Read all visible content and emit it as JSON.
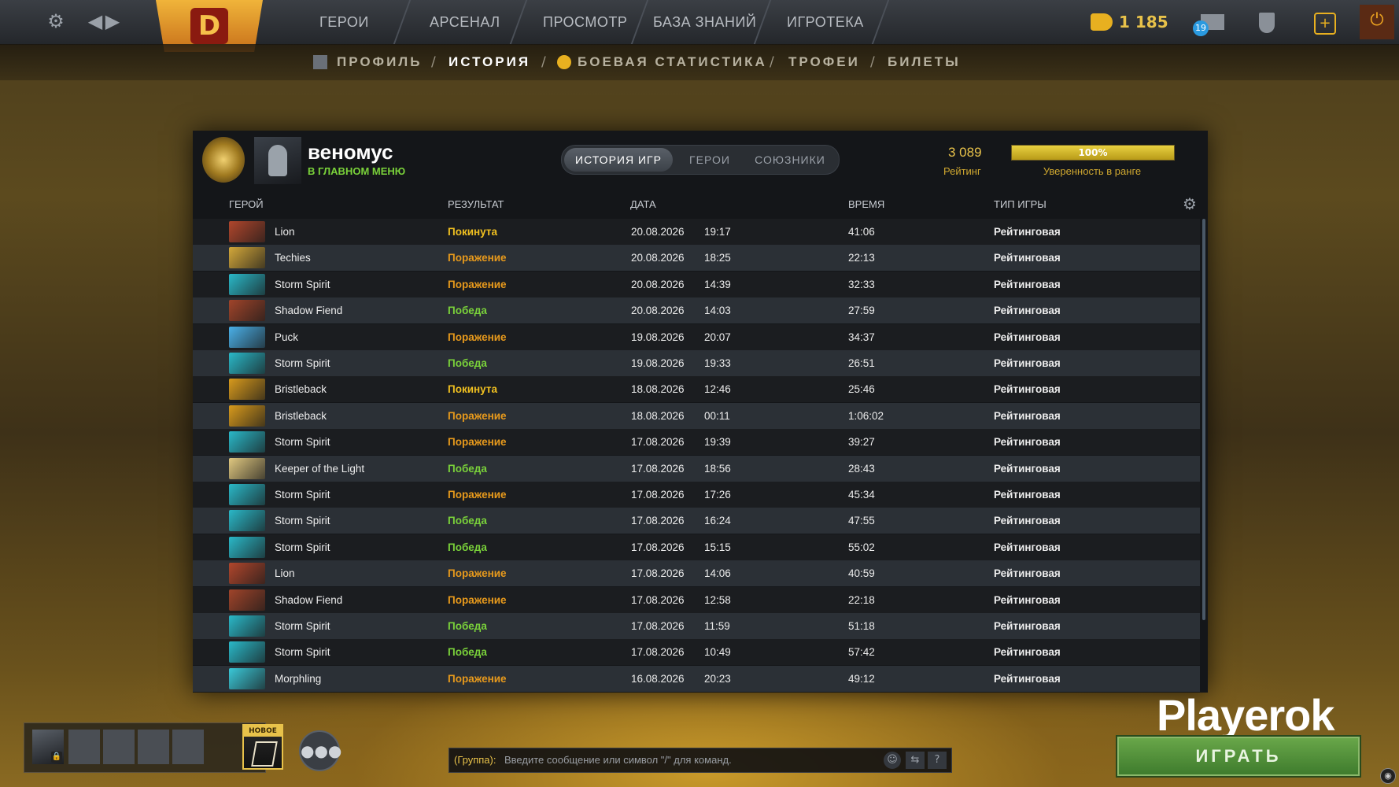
{
  "topbar": {
    "nav": [
      "ГЕРОИ",
      "АРСЕНАЛ",
      "ПРОСМОТР",
      "БАЗА ЗНАНИЙ",
      "ИГРОТЕКА"
    ],
    "gold": "1 185",
    "mail_count": "19"
  },
  "subnav": {
    "items": [
      "ПРОФИЛЬ",
      "ИСТОРИЯ",
      "БОЕВАЯ СТАТИСТИКА",
      "ТРОФЕИ",
      "БИЛЕТЫ"
    ],
    "active": "ИСТОРИЯ"
  },
  "profile": {
    "name": "веномус",
    "status": "В ГЛАВНОМ МЕНЮ",
    "tabs": [
      "ИСТОРИЯ ИГР",
      "ГЕРОИ",
      "СОЮЗНИКИ"
    ],
    "rating_value": "3 089",
    "rating_label": "Рейтинг",
    "confidence_percent": 100,
    "confidence_text": "100%",
    "confidence_label": "Уверенность в ранге"
  },
  "table": {
    "headers": [
      "ГЕРОЙ",
      "РЕЗУЛЬТАТ",
      "ДАТА",
      "ВРЕМЯ",
      "ТИП ИГРЫ"
    ],
    "rows": [
      {
        "hero": "Lion",
        "result": "Покинута",
        "date": "20.08.2026",
        "time": "19:17",
        "duration": "41:06",
        "type": "Рейтинговая"
      },
      {
        "hero": "Techies",
        "result": "Поражение",
        "date": "20.08.2026",
        "time": "18:25",
        "duration": "22:13",
        "type": "Рейтинговая"
      },
      {
        "hero": "Storm Spirit",
        "result": "Поражение",
        "date": "20.08.2026",
        "time": "14:39",
        "duration": "32:33",
        "type": "Рейтинговая"
      },
      {
        "hero": "Shadow Fiend",
        "result": "Победа",
        "date": "20.08.2026",
        "time": "14:03",
        "duration": "27:59",
        "type": "Рейтинговая"
      },
      {
        "hero": "Puck",
        "result": "Поражение",
        "date": "19.08.2026",
        "time": "20:07",
        "duration": "34:37",
        "type": "Рейтинговая"
      },
      {
        "hero": "Storm Spirit",
        "result": "Победа",
        "date": "19.08.2026",
        "time": "19:33",
        "duration": "26:51",
        "type": "Рейтинговая"
      },
      {
        "hero": "Bristleback",
        "result": "Покинута",
        "date": "18.08.2026",
        "time": "12:46",
        "duration": "25:46",
        "type": "Рейтинговая"
      },
      {
        "hero": "Bristleback",
        "result": "Поражение",
        "date": "18.08.2026",
        "time": "00:11",
        "duration": "1:06:02",
        "type": "Рейтинговая"
      },
      {
        "hero": "Storm Spirit",
        "result": "Поражение",
        "date": "17.08.2026",
        "time": "19:39",
        "duration": "39:27",
        "type": "Рейтинговая"
      },
      {
        "hero": "Keeper of the Light",
        "result": "Победа",
        "date": "17.08.2026",
        "time": "18:56",
        "duration": "28:43",
        "type": "Рейтинговая"
      },
      {
        "hero": "Storm Spirit",
        "result": "Поражение",
        "date": "17.08.2026",
        "time": "17:26",
        "duration": "45:34",
        "type": "Рейтинговая"
      },
      {
        "hero": "Storm Spirit",
        "result": "Победа",
        "date": "17.08.2026",
        "time": "16:24",
        "duration": "47:55",
        "type": "Рейтинговая"
      },
      {
        "hero": "Storm Spirit",
        "result": "Победа",
        "date": "17.08.2026",
        "time": "15:15",
        "duration": "55:02",
        "type": "Рейтинговая"
      },
      {
        "hero": "Lion",
        "result": "Поражение",
        "date": "17.08.2026",
        "time": "14:06",
        "duration": "40:59",
        "type": "Рейтинговая"
      },
      {
        "hero": "Shadow Fiend",
        "result": "Поражение",
        "date": "17.08.2026",
        "time": "12:58",
        "duration": "22:18",
        "type": "Рейтинговая"
      },
      {
        "hero": "Storm Spirit",
        "result": "Победа",
        "date": "17.08.2026",
        "time": "11:59",
        "duration": "51:18",
        "type": "Рейтинговая"
      },
      {
        "hero": "Storm Spirit",
        "result": "Победа",
        "date": "17.08.2026",
        "time": "10:49",
        "duration": "57:42",
        "type": "Рейтинговая"
      },
      {
        "hero": "Morphling",
        "result": "Поражение",
        "date": "16.08.2026",
        "time": "20:23",
        "duration": "49:12",
        "type": "Рейтинговая"
      }
    ]
  },
  "colors": {
    "win": "#7ad23a",
    "loss": "#e89a1c",
    "abandon": "#f0c020",
    "hero_thumbs": {
      "Lion": "#b0462c",
      "Techies": "#d4a83a",
      "Storm Spirit": "#2ab8c8",
      "Shadow Fiend": "#a0442a",
      "Puck": "#4ab0e8",
      "Bristleback": "#d89a1c",
      "Keeper of the Light": "#e0c880",
      "Morphling": "#3ac8d8"
    }
  },
  "bottom": {
    "new_badge": "НОВОЕ",
    "chat_group": "(Группа):",
    "chat_placeholder": "Введите сообщение или символ \"/\" для команд.",
    "brand": "Playerok",
    "play_label": "ИГРАТЬ"
  }
}
